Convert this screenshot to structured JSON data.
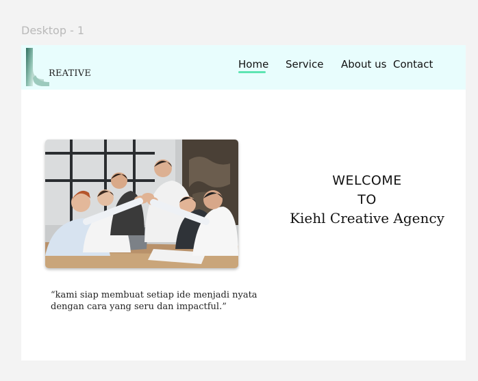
{
  "canvas": {
    "frame_label": "Desktop - 1"
  },
  "logo": {
    "letter": "k",
    "wordmark": "REATIVE"
  },
  "nav": {
    "items": [
      {
        "label": "Home",
        "active": true
      },
      {
        "label": "Service"
      },
      {
        "label": "About us"
      },
      {
        "label": "Contact"
      }
    ],
    "accent": "#5de4b2"
  },
  "hero": {
    "image_alt": "team high-five photo",
    "quote": "“kami siap membuat setiap ide menjadi nyata dengan cara yang seru dan impactful.”",
    "welcome_line1": "WELCOME",
    "welcome_line2": "TO",
    "agency": "Kiehl Creative Agency"
  },
  "colors": {
    "navbar_bg": "#e8fdfd",
    "logo_teal": "#4f8f7f"
  }
}
